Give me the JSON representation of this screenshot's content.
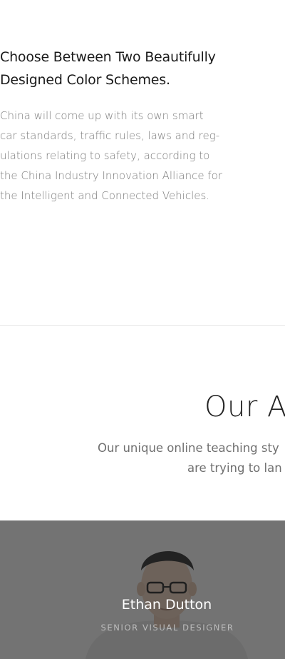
{
  "feature": {
    "title": "Choose Between Two Beautifully Designed Color Schemes.",
    "body": "China will come up with its own smart car standards, traffic rules, laws and reg-ulations relating to safety, according to the China Industry Innovation Alliance for the Intelligent and Connected Vehicles."
  },
  "team_section": {
    "heading": "Our A",
    "subtitle_line_1": "Our unique online teaching sty",
    "subtitle_line_2": "are trying to lan"
  },
  "team_card": {
    "name": "Ethan Dutton",
    "role": "Senior Visual Designer",
    "portrait_icon": "person-portrait"
  },
  "colors": {
    "heading": "#222222",
    "body_text": "#7a7a7a",
    "overlay": "#282828",
    "divider": "#e6e6e6"
  }
}
